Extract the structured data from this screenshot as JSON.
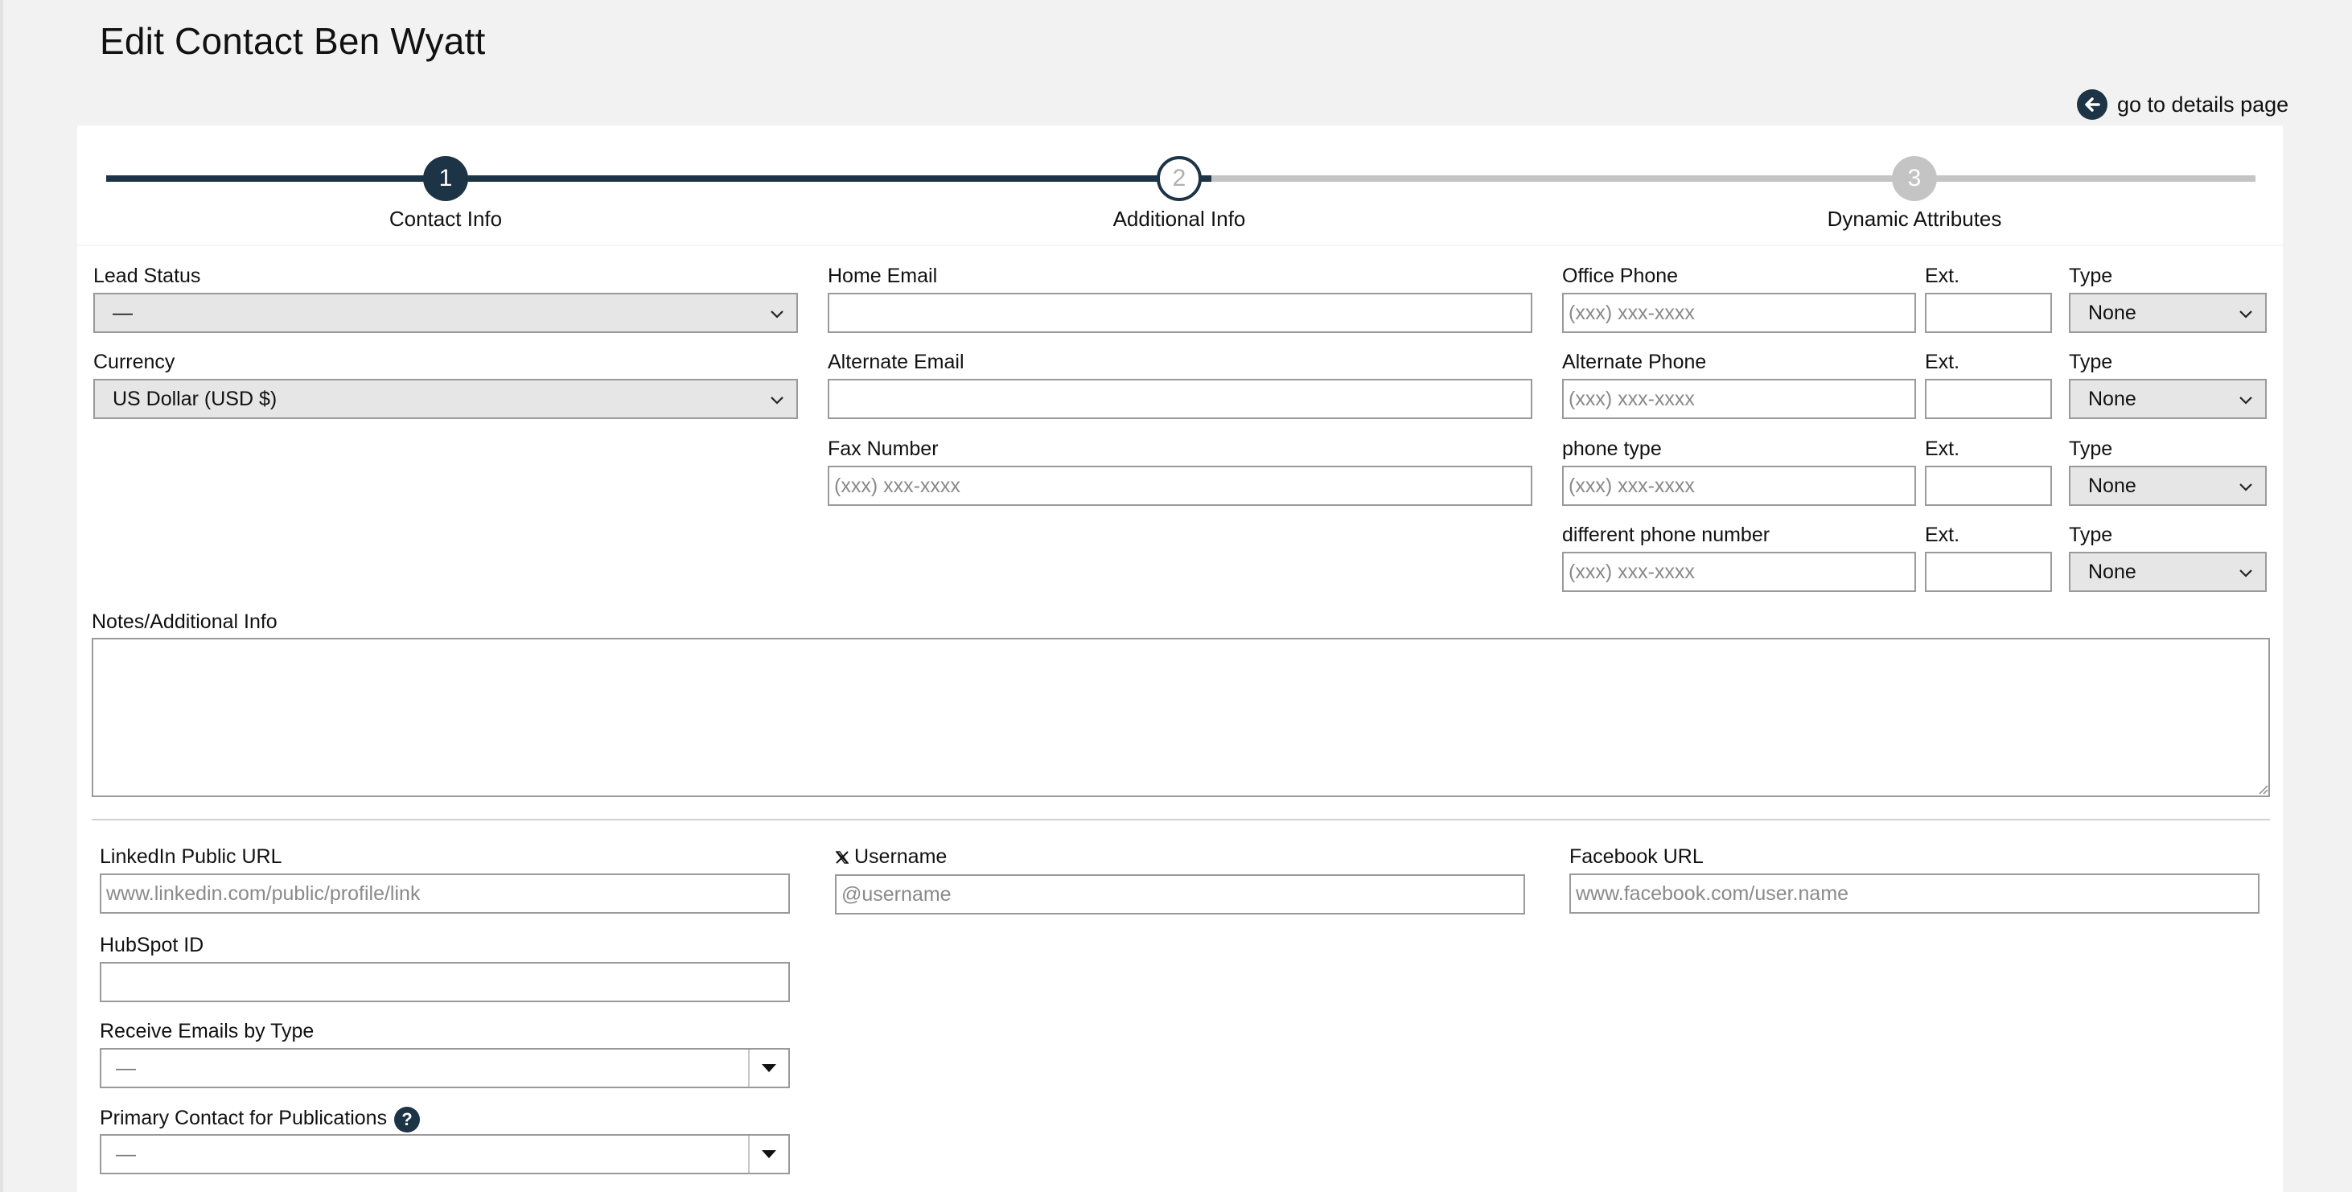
{
  "page": {
    "title": "Edit Contact Ben Wyatt",
    "back_link": "go to details page"
  },
  "stepper": {
    "steps": [
      {
        "number": "1",
        "label": "Contact Info",
        "state": "complete"
      },
      {
        "number": "2",
        "label": "Additional Info",
        "state": "current"
      },
      {
        "number": "3",
        "label": "Dynamic Attributes",
        "state": "upcoming"
      }
    ]
  },
  "column1": {
    "lead_status": {
      "label": "Lead Status",
      "value": "—"
    },
    "currency": {
      "label": "Currency",
      "value": "US Dollar (USD $)"
    }
  },
  "column2": {
    "home_email": {
      "label": "Home Email",
      "value": "",
      "placeholder": ""
    },
    "alternate_email": {
      "label": "Alternate Email",
      "value": "",
      "placeholder": ""
    },
    "fax_number": {
      "label": "Fax Number",
      "value": "",
      "placeholder": "(xxx) xxx-xxxx"
    }
  },
  "phones": [
    {
      "label": "Office Phone",
      "placeholder": "(xxx) xxx-xxxx",
      "ext_label": "Ext.",
      "type_label": "Type",
      "type_value": "None"
    },
    {
      "label": "Alternate Phone",
      "placeholder": "(xxx) xxx-xxxx",
      "ext_label": "Ext.",
      "type_label": "Type",
      "type_value": "None"
    },
    {
      "label": "phone type",
      "placeholder": "(xxx) xxx-xxxx",
      "ext_label": "Ext.",
      "type_label": "Type",
      "type_value": "None"
    },
    {
      "label": "different phone number",
      "placeholder": "(xxx) xxx-xxxx",
      "ext_label": "Ext.",
      "type_label": "Type",
      "type_value": "None"
    }
  ],
  "notes": {
    "label": "Notes/Additional Info",
    "value": ""
  },
  "social": {
    "linkedin": {
      "label": "LinkedIn Public URL",
      "placeholder": "www.linkedin.com/public/profile/link"
    },
    "x_username": {
      "icon": "x-logo-icon",
      "label": "Username",
      "placeholder": "@username"
    },
    "facebook": {
      "label": "Facebook URL",
      "placeholder": "www.facebook.com/user.name"
    }
  },
  "hubspot": {
    "label": "HubSpot ID",
    "value": ""
  },
  "receive_emails": {
    "label": "Receive Emails by Type",
    "value": "—"
  },
  "primary_contact": {
    "label": "Primary Contact for Publications",
    "value": "—",
    "help_icon": "question-icon"
  },
  "colors": {
    "accent": "#1c3445",
    "page_bg": "#f2f2f2",
    "track_inactive": "#c4c4c4"
  }
}
